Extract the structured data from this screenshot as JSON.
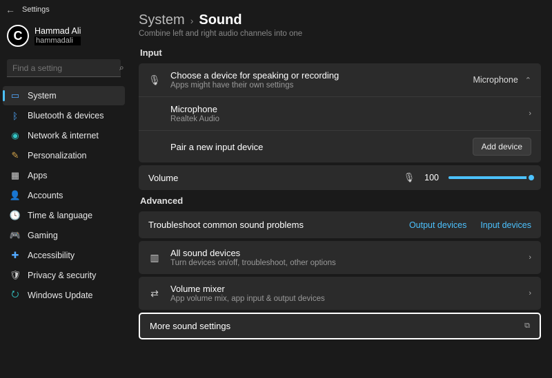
{
  "topbar": {
    "title": "Settings"
  },
  "profile": {
    "name": "Hammad Ali",
    "username": "hammadali"
  },
  "search": {
    "placeholder": "Find a setting"
  },
  "nav": {
    "items": [
      {
        "label": "System"
      },
      {
        "label": "Bluetooth & devices"
      },
      {
        "label": "Network & internet"
      },
      {
        "label": "Personalization"
      },
      {
        "label": "Apps"
      },
      {
        "label": "Accounts"
      },
      {
        "label": "Time & language"
      },
      {
        "label": "Gaming"
      },
      {
        "label": "Accessibility"
      },
      {
        "label": "Privacy & security"
      },
      {
        "label": "Windows Update"
      }
    ]
  },
  "breadcrumb": {
    "parent": "System",
    "current": "Sound"
  },
  "subline": "Combine left and right audio channels into one",
  "sections": {
    "input": {
      "title": "Input",
      "choose": {
        "title": "Choose a device for speaking or recording",
        "sub": "Apps might have their own settings",
        "value": "Microphone"
      },
      "mic": {
        "title": "Microphone",
        "sub": "Realtek Audio"
      },
      "pair": {
        "title": "Pair a new input device",
        "button": "Add device"
      },
      "volume": {
        "label": "Volume",
        "value": "100"
      }
    },
    "advanced": {
      "title": "Advanced",
      "troubleshoot": {
        "title": "Troubleshoot common sound problems",
        "link1": "Output devices",
        "link2": "Input devices"
      },
      "allDevices": {
        "title": "All sound devices",
        "sub": "Turn devices on/off, troubleshoot, other options"
      },
      "mixer": {
        "title": "Volume mixer",
        "sub": "App volume mix, app input & output devices"
      },
      "more": {
        "title": "More sound settings"
      }
    }
  }
}
